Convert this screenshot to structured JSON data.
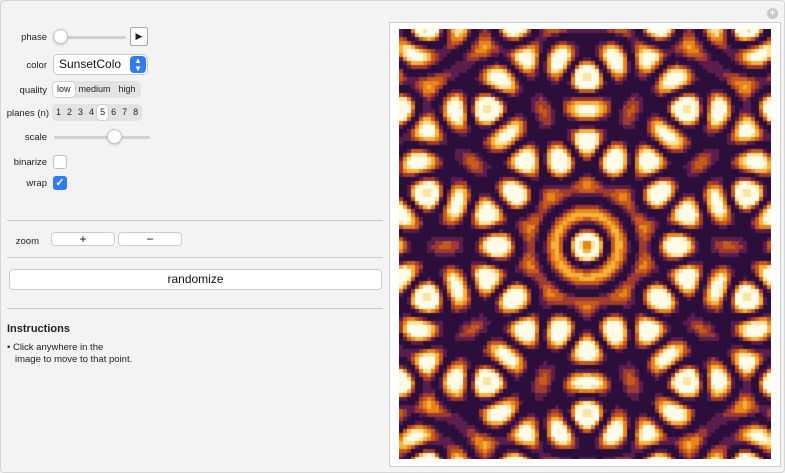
{
  "controls": {
    "phase_label": "phase",
    "phase_value": 0.0,
    "play_icon": "play-triangle",
    "color_label": "color",
    "color_value": "SunsetColo",
    "quality_label": "quality",
    "quality_options": [
      "low",
      "medium",
      "high"
    ],
    "quality_selected": "low",
    "planes_label": "planes (n)",
    "planes_options": [
      "1",
      "2",
      "3",
      "4",
      "5",
      "6",
      "7",
      "8"
    ],
    "planes_selected": "5",
    "scale_label": "scale",
    "scale_value": 0.5,
    "binarize_label": "binarize",
    "binarize_checked": false,
    "wrap_label": "wrap",
    "wrap_checked": true
  },
  "zoom": {
    "label": "zoom",
    "plus_label": "+",
    "minus_label": "−"
  },
  "randomize_label": "randomize",
  "instructions": {
    "title": "Instructions",
    "line1": "• Click anywhere in the",
    "line2": "image to move to that point."
  },
  "colors": {
    "accent": "#2f7cf6",
    "palette": [
      "#2b0f3a",
      "#5a1d4d",
      "#9e3a2f",
      "#c45a1c",
      "#e8851a",
      "#f6b23c",
      "#fde3a0",
      "#fffbe8"
    ]
  },
  "image": {
    "description_icon": "quasicrystal-pattern",
    "planes": 5
  }
}
